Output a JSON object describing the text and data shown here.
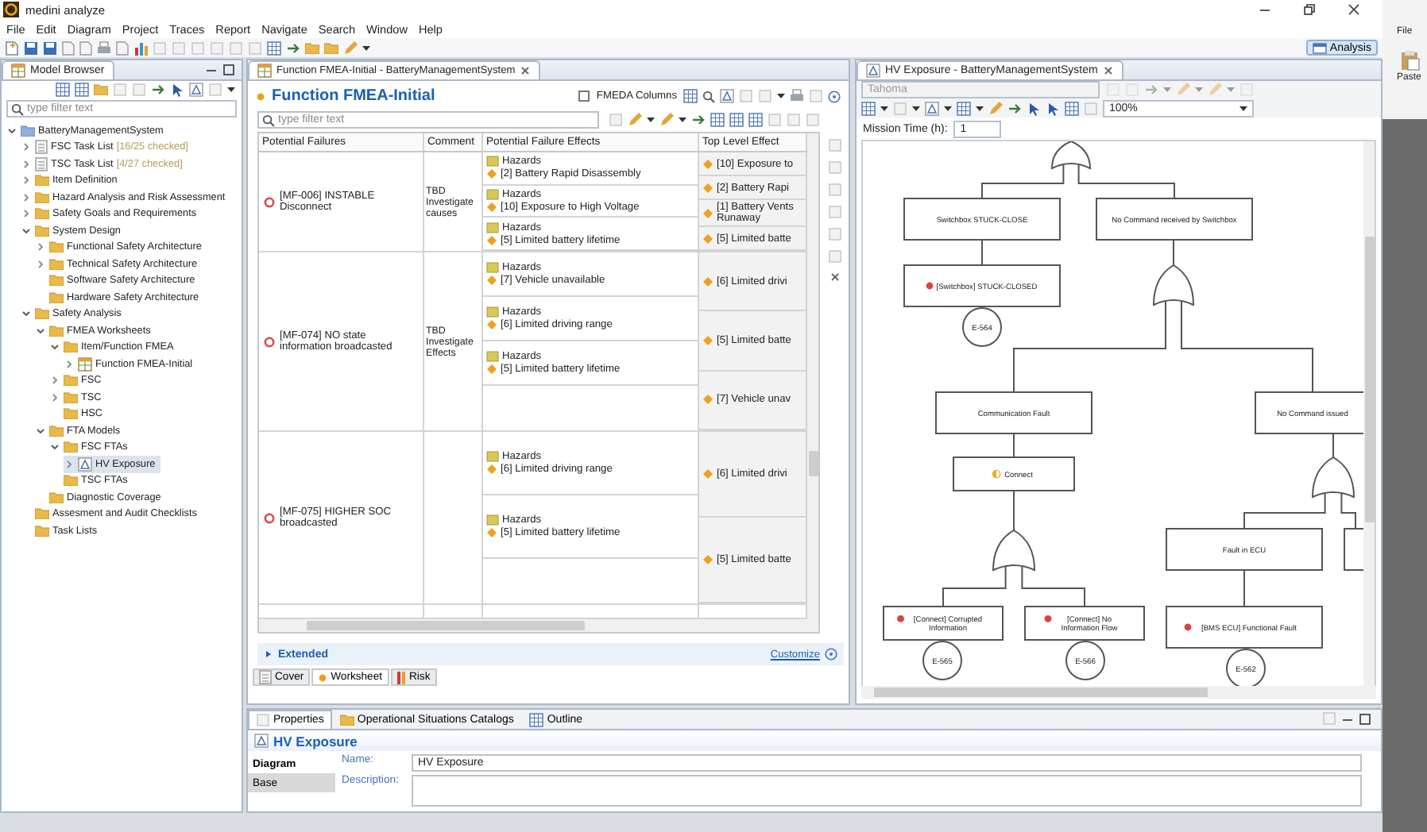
{
  "window": {
    "title": "medini analyze"
  },
  "menu": [
    "File",
    "Edit",
    "Diagram",
    "Project",
    "Traces",
    "Report",
    "Navigate",
    "Search",
    "Window",
    "Help"
  ],
  "perspective": {
    "label": "Analysis",
    "selected": true
  },
  "model_browser": {
    "title": "Model Browser",
    "filter": {
      "placeholder": "type filter text"
    },
    "tree": [
      {
        "label": "BatteryManagementSystem",
        "kind": "project",
        "expanded": true,
        "selected": false,
        "children": [
          {
            "label": "FSC Task List",
            "note": "[16/25 checked]",
            "kind": "tasklist",
            "expanded": false,
            "selected": false
          },
          {
            "label": "TSC Task List",
            "note": "[4/27 checked]",
            "kind": "tasklist",
            "expanded": false,
            "selected": false
          },
          {
            "label": "Item Definition",
            "kind": "folder",
            "expanded": false,
            "selected": false
          },
          {
            "label": "Hazard Analysis and Risk Assessment",
            "kind": "folder",
            "expanded": false,
            "selected": false
          },
          {
            "label": "Safety Goals and Requirements",
            "kind": "folder",
            "expanded": false,
            "selected": false
          },
          {
            "label": "System Design",
            "kind": "folder",
            "expanded": true,
            "selected": false,
            "children": [
              {
                "label": "Functional Safety Architecture",
                "kind": "folder",
                "expanded": false,
                "selected": false
              },
              {
                "label": "Technical Safety Architecture",
                "kind": "folder",
                "expanded": false,
                "selected": false
              },
              {
                "label": "Software Safety Architecture",
                "kind": "folder",
                "selected": false
              },
              {
                "label": "Hardware Safety Architecture",
                "kind": "folder",
                "selected": false
              }
            ]
          },
          {
            "label": "Safety Analysis",
            "kind": "folder",
            "expanded": true,
            "selected": false,
            "children": [
              {
                "label": "FMEA Worksheets",
                "kind": "folder",
                "expanded": true,
                "selected": false,
                "children": [
                  {
                    "label": "Item/Function FMEA",
                    "kind": "folder",
                    "expanded": true,
                    "selected": false,
                    "children": [
                      {
                        "label": "Function FMEA-Initial",
                        "kind": "worksheet",
                        "expanded": false,
                        "selected": false
                      }
                    ]
                  },
                  {
                    "label": "FSC",
                    "kind": "folder",
                    "expanded": false,
                    "selected": false
                  },
                  {
                    "label": "TSC",
                    "kind": "folder",
                    "expanded": false,
                    "selected": false
                  },
                  {
                    "label": "HSC",
                    "kind": "folder",
                    "selected": false
                  }
                ]
              },
              {
                "label": "FTA Models",
                "kind": "folder",
                "expanded": true,
                "selected": false,
                "children": [
                  {
                    "label": "FSC FTAs",
                    "kind": "folder",
                    "expanded": true,
                    "selected": false,
                    "children": [
                      {
                        "label": "HV Exposure",
                        "kind": "diagram",
                        "expanded": false,
                        "selected": true
                      }
                    ]
                  },
                  {
                    "label": "TSC FTAs",
                    "kind": "folder",
                    "selected": false
                  }
                ]
              },
              {
                "label": "Diagnostic Coverage",
                "kind": "folder",
                "selected": false
              }
            ]
          },
          {
            "label": "Assesment and Audit Checklists",
            "kind": "folder",
            "selected": false
          },
          {
            "label": "Task Lists",
            "kind": "folder",
            "selected": false
          }
        ]
      }
    ]
  },
  "fmea": {
    "tab": "Function FMEA-Initial - BatteryManagementSystem",
    "title": "Function FMEA-Initial",
    "fmeda_columns": {
      "label": "FMEDA Columns",
      "checked": false
    },
    "filter": {
      "placeholder": "type filter text"
    },
    "columns": [
      "Potential Failures",
      "Comment",
      "Potential Failure Effects",
      "Top Level Effect"
    ],
    "rows": [
      {
        "failure": "[MF-006] INSTABLE Disconnect",
        "comment": "TBD Investigate causes",
        "effects": [
          {
            "group": "Hazards",
            "effect": "[2] Battery Rapid Disassembly"
          },
          {
            "group": "Hazards",
            "effect": "[10] Exposure to High Voltage"
          },
          {
            "group": "Hazards",
            "effect": "[5] Limited battery lifetime"
          }
        ],
        "top_level_effects": [
          "[10] Exposure to",
          "[2] Battery Rapi",
          "[1] Battery Vents Runaway",
          "[5] Limited batte"
        ]
      },
      {
        "failure": "[MF-074] NO state information broadcasted",
        "comment": "TBD Investigate Effects",
        "effects": [
          {
            "group": "Hazards",
            "effect": "[7] Vehicle unavailable"
          },
          {
            "group": "Hazards",
            "effect": "[6] Limited driving range"
          },
          {
            "group": "Hazards",
            "effect": "[5] Limited battery lifetime"
          }
        ],
        "top_level_effects": [
          "[6] Limited drivi",
          "[5] Limited batte",
          "[7] Vehicle unav"
        ]
      },
      {
        "failure": "[MF-075] HIGHER SOC broadcasted",
        "effects": [
          {
            "group": "Hazards",
            "effect": "[6] Limited driving range"
          },
          {
            "group": "Hazards",
            "effect": "[5] Limited battery lifetime"
          }
        ],
        "top_level_effects": [
          "[6] Limited drivi",
          "[5] Limited batte"
        ]
      }
    ],
    "extended": "Extended",
    "customize": "Customize",
    "sheet_tabs": [
      {
        "label": "Cover",
        "selected": false
      },
      {
        "label": "Worksheet",
        "selected": true
      },
      {
        "label": "Risk",
        "selected": false
      }
    ]
  },
  "fta": {
    "tab": "HV Exposure - BatteryManagementSystem",
    "font": "Tahoma",
    "zoom": "100%",
    "mission_time": {
      "label": "Mission Time (h):",
      "value": "1"
    },
    "nodes": [
      {
        "kind": "gate"
      },
      {
        "kind": "event",
        "label": "Switchbox STUCK-CLOSE"
      },
      {
        "kind": "event",
        "label": "No Command received by Switchbox"
      },
      {
        "kind": "basic",
        "label": "[Switchbox] STUCK-CLOSED"
      },
      {
        "kind": "circle",
        "label": "E-564"
      },
      {
        "kind": "gate"
      },
      {
        "kind": "event",
        "label": "Communication Fault"
      },
      {
        "kind": "event",
        "label": "No Command issued"
      },
      {
        "kind": "transfer",
        "label": "Connect"
      },
      {
        "kind": "gate"
      },
      {
        "kind": "basic",
        "label": "[Connect] Corrupted Information"
      },
      {
        "kind": "basic",
        "label": "[Connect] No Information Flow"
      },
      {
        "kind": "circle",
        "label": "E-565"
      },
      {
        "kind": "circle",
        "label": "E-566"
      },
      {
        "kind": "gate"
      },
      {
        "kind": "event",
        "label": "Fault in ECU"
      },
      {
        "kind": "event"
      },
      {
        "kind": "basic",
        "label": "[BMS ECU] Functional Fault"
      },
      {
        "kind": "circle",
        "label": "E-562"
      }
    ]
  },
  "properties": {
    "tabs": [
      {
        "label": "Properties",
        "selected": true
      },
      {
        "label": "Operational Situations Catalogs",
        "selected": false
      },
      {
        "label": "Outline",
        "selected": false
      }
    ],
    "title": "HV Exposure",
    "sections": [
      {
        "label": "Diagram",
        "selected": true
      },
      {
        "label": "Base",
        "selected": false
      }
    ],
    "fields": [
      {
        "label": "Name:",
        "value": "HV Exposure"
      },
      {
        "label": "Description:"
      }
    ]
  },
  "side_panel": {
    "menu": "File",
    "paste": "Paste"
  }
}
